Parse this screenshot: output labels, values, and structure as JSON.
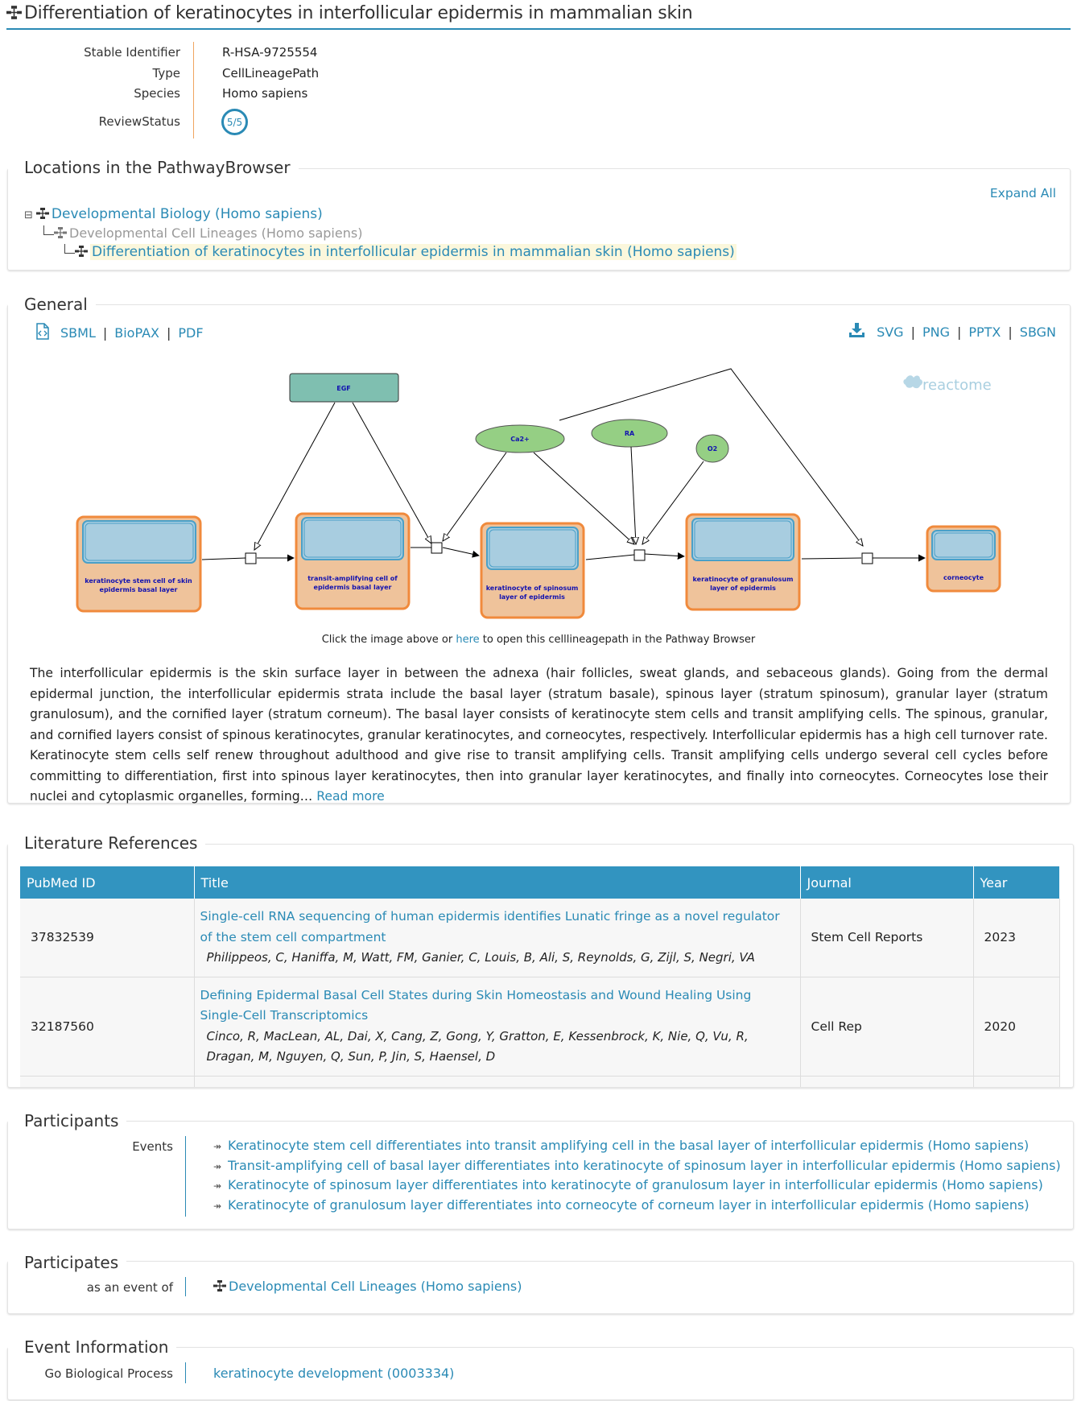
{
  "header": {
    "title": "Differentiation of keratinocytes in interfollicular epidermis in mammalian skin"
  },
  "details": {
    "rows": [
      {
        "label": "Stable Identifier",
        "value": "R-HSA-9725554"
      },
      {
        "label": "Type",
        "value": "CellLineagePath"
      },
      {
        "label": "Species",
        "value": "Homo sapiens"
      }
    ],
    "review_label": "ReviewStatus",
    "review_badge": "5/5"
  },
  "locations": {
    "legend": "Locations in the PathwayBrowser",
    "expand_all": "Expand All",
    "collapse_symbol": "⊟",
    "tree": [
      {
        "label": "Developmental Biology (Homo sapiens)",
        "state": "link"
      },
      {
        "label": "Developmental Cell Lineages (Homo sapiens)",
        "state": "muted"
      },
      {
        "label": "Differentiation of keratinocytes in interfollicular epidermis in mammalian skin (Homo sapiens)",
        "state": "highlighted"
      }
    ]
  },
  "general": {
    "legend": "General",
    "downloads_left": [
      "SBML",
      "BioPAX",
      "PDF"
    ],
    "downloads_right": [
      "SVG",
      "PNG",
      "PPTX",
      "SBGN"
    ],
    "separator": "|",
    "diagram": {
      "watermark": "reactome",
      "cells": [
        "keratinocyte stem cell of skin epidermis basal layer",
        "transit-amplifying cell of epidermis basal layer",
        "keratinocyte of spinosum layer of epidermis",
        "keratinocyte of granulosum layer of epidermis",
        "corneocyte"
      ],
      "rect_entity": "EGF",
      "ellipse_entities": [
        "Ca2+",
        "RA",
        "O2"
      ]
    },
    "caption_pre": "Click the image above or",
    "caption_link": "here",
    "caption_post": "to open this celllineagepath in the Pathway Browser",
    "description": "The interfollicular epidermis is the skin surface layer in between the adnexa (hair follicles, sweat glands, and sebaceous glands). Going from the dermal epidermal junction, the interfollicular epidermis strata include the basal layer (stratum basale), spinous layer (stratum spinosum), granular layer (stratum granulosum), and the cornified layer (stratum corneum). The basal layer consists of keratinocyte stem cells and transit amplifying cells. The spinous, granular, and cornified layers consist of spinous keratinocytes, granular keratinocytes, and corneocytes, respectively. Interfollicular epidermis has a high cell turnover rate. Keratinocyte stem cells self renew throughout adulthood and give rise to transit amplifying cells. Transit amplifying cells undergo several cell cycles before committing to differentiation, first into spinous layer keratinocytes, then into granular layer keratinocytes, and finally into corneocytes. Corneocytes lose their nuclei and cytoplasmic organelles, forming…",
    "read_more": "Read more"
  },
  "literature": {
    "legend": "Literature References",
    "columns": [
      "PubMed ID",
      "Title",
      "Journal",
      "Year"
    ],
    "rows": [
      {
        "pmid": "37832539",
        "title": "Single-cell RNA sequencing of human epidermis identifies Lunatic fringe as a novel regulator of the stem cell compartment",
        "authors": "Philippeos, C, Haniffa, M, Watt, FM, Ganier, C, Louis, B, Ali, S, Reynolds, G, Zijl, S, Negri, VA",
        "journal": "Stem Cell Reports",
        "year": "2023"
      },
      {
        "pmid": "32187560",
        "title": "Defining Epidermal Basal Cell States during Skin Homeostasis and Wound Healing Using Single-Cell Transcriptomics",
        "authors": "Cinco, R, MacLean, AL, Dai, X, Cang, Z, Gong, Y, Gratton, E, Kessenbrock, K, Nie, Q, Vu, R, Dragan, M, Nguyen, Q, Sun, P, Jin, S, Haensel, D",
        "journal": "Cell Rep",
        "year": "2020"
      }
    ]
  },
  "participants": {
    "legend": "Participants",
    "label": "Events",
    "items": [
      "Keratinocyte stem cell differentiates into transit amplifying cell in the basal layer of interfollicular epidermis (Homo sapiens)",
      "Transit-amplifying cell of basal layer differentiates into keratinocyte of spinosum layer in interfollicular epidermis (Homo sapiens)",
      "Keratinocyte of spinosum layer differentiates into keratinocyte of granulosum layer in interfollicular epidermis (Homo sapiens)",
      "Keratinocyte of granulosum layer differentiates into corneocyte of corneum layer in interfollicular epidermis (Homo sapiens)"
    ]
  },
  "participates": {
    "legend": "Participates",
    "label": "as an event of",
    "item": "Developmental Cell Lineages (Homo sapiens)"
  },
  "event_info": {
    "legend": "Event Information",
    "label": "Go Biological Process",
    "item": "keratinocyte development (0003334)"
  },
  "colors": {
    "accent": "#2a8ab5",
    "header_table": "#3294c0",
    "cell_fill": "#efc39b",
    "cell_border": "#f08a3c",
    "inner_fill": "#a8cde0",
    "entity_green": "#95cf84",
    "egf_fill": "#7fbfb0"
  }
}
